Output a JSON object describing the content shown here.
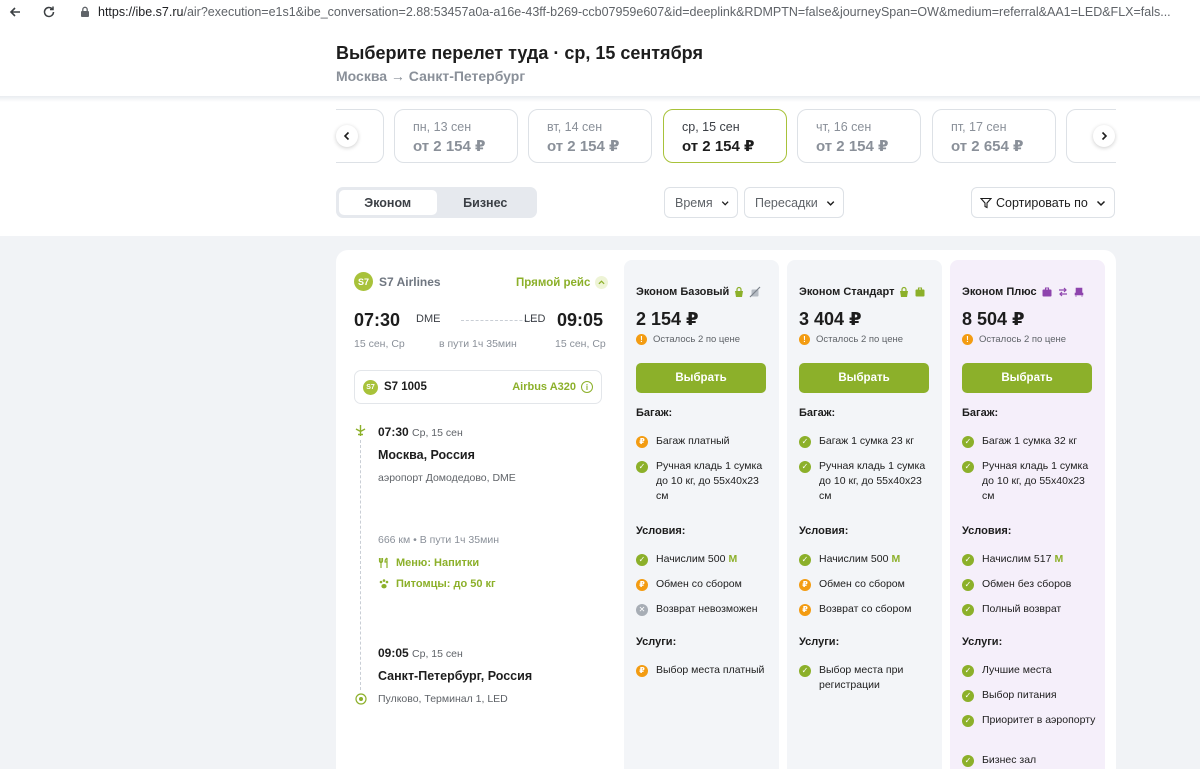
{
  "browser": {
    "url_host": "https://ibe.s7.ru",
    "url_rest": "/air?execution=e1s1&ibe_conversation=2.88:53457a0a-a16e-43ff-b269-ccb07959e607&id=deeplink&RDMPTN=false&journeySpan=OW&medium=referral&AA1=LED&FLX=fals..."
  },
  "header": {
    "title": "Выберите перелет туда · ср, 15 сентября",
    "route": "Москва → Санкт-Петербург"
  },
  "dates": [
    {
      "day": "пн, 13 сен",
      "price": "от 2 154 ₽"
    },
    {
      "day": "вт, 14 сен",
      "price": "от 2 154 ₽"
    },
    {
      "day": "ср, 15 сен",
      "price": "от 2 154 ₽"
    },
    {
      "day": "чт, 16 сен",
      "price": "от 2 154 ₽"
    },
    {
      "day": "пт, 17 сен",
      "price": "от 2 654 ₽"
    }
  ],
  "class_toggle": {
    "economy": "Эконом",
    "business": "Бизнес"
  },
  "filters": {
    "time": "Время",
    "transfers": "Пересадки",
    "sort": "Сортировать по"
  },
  "flight": {
    "logo": "S7",
    "airline": "S7 Airlines",
    "direct": "Прямой рейс",
    "dep_time": "07:30",
    "dep_code": "DME",
    "arr_code": "LED",
    "arr_time": "09:05",
    "dep_date": "15 сен, Ср",
    "duration": "в пути 1ч 35мин",
    "arr_date": "15 сен, Ср",
    "number": "S7 1005",
    "aircraft": "Airbus A320",
    "tl_dep_time": "07:30",
    "tl_dep_day": "Ср, 15 сен",
    "dep_city": "Москва, Россия",
    "dep_airport": "аэропорт Домодедово, DME",
    "distance": "666 км • В пути 1ч 35мин",
    "menu": "Меню: Напитки",
    "pets": "Питомцы: до 50 кг",
    "tl_arr_time": "09:05",
    "tl_arr_day": "Ср, 15 сен",
    "arr_city": "Санкт-Петербург, Россия",
    "arr_airport": "Пулково, Терминал 1, LED"
  },
  "fares": [
    {
      "name": "Эконом Базовый",
      "price": "2 154 ₽",
      "left": "Осталось 2 по цене",
      "button": "Выбрать",
      "baggage_title": "Багаж:",
      "baggage": [
        {
          "status": "pay",
          "text": "Багаж платный"
        },
        {
          "status": "ok",
          "text": "Ручная кладь 1 сумка до 10 кг, до 55x40x23 см"
        }
      ],
      "conditions_title": "Условия:",
      "conditions": [
        {
          "status": "ok",
          "text": "Начислим 500"
        },
        {
          "status": "pay",
          "text": "Обмен со сбором"
        },
        {
          "status": "no",
          "text": "Возврат невозможен"
        }
      ],
      "services_title": "Услуги:",
      "services": [
        {
          "status": "pay",
          "text": "Выбор места платный"
        }
      ]
    },
    {
      "name": "Эконом Стандарт",
      "price": "3 404 ₽",
      "left": "Осталось 2 по цене",
      "button": "Выбрать",
      "baggage_title": "Багаж:",
      "baggage": [
        {
          "status": "ok",
          "text": "Багаж 1 сумка 23 кг"
        },
        {
          "status": "ok",
          "text": "Ручная кладь 1 сумка до 10 кг, до 55x40x23 см"
        }
      ],
      "conditions_title": "Условия:",
      "conditions": [
        {
          "status": "ok",
          "text": "Начислим 500"
        },
        {
          "status": "pay",
          "text": "Обмен со сбором"
        },
        {
          "status": "pay",
          "text": "Возврат со сбором"
        }
      ],
      "services_title": "Услуги:",
      "services": [
        {
          "status": "ok",
          "text": "Выбор места при регистрации"
        }
      ]
    },
    {
      "name": "Эконом Плюс",
      "price": "8 504 ₽",
      "left": "Осталось 2 по цене",
      "button": "Выбрать",
      "baggage_title": "Багаж:",
      "baggage": [
        {
          "status": "ok",
          "text": "Багаж 1 сумка 32 кг"
        },
        {
          "status": "ok",
          "text": "Ручная кладь 1 сумка до 10 кг, до 55x40x23 см"
        }
      ],
      "conditions_title": "Условия:",
      "conditions": [
        {
          "status": "ok",
          "text": "Начислим 517"
        },
        {
          "status": "ok",
          "text": "Обмен без сборов"
        },
        {
          "status": "ok",
          "text": "Полный возврат"
        }
      ],
      "services_title": "Услуги:",
      "services": [
        {
          "status": "ok",
          "text": "Лучшие места"
        },
        {
          "status": "ok",
          "text": "Выбор питания"
        },
        {
          "status": "ok",
          "text": "Приоритет в аэропорту"
        },
        {
          "status": "ok",
          "text": "Бизнес зал"
        }
      ]
    }
  ],
  "miles_symbol": "M",
  "colors": {
    "accent": "#8cb02a",
    "warning": "#f39c12",
    "plus_bg": "#f5effa"
  }
}
